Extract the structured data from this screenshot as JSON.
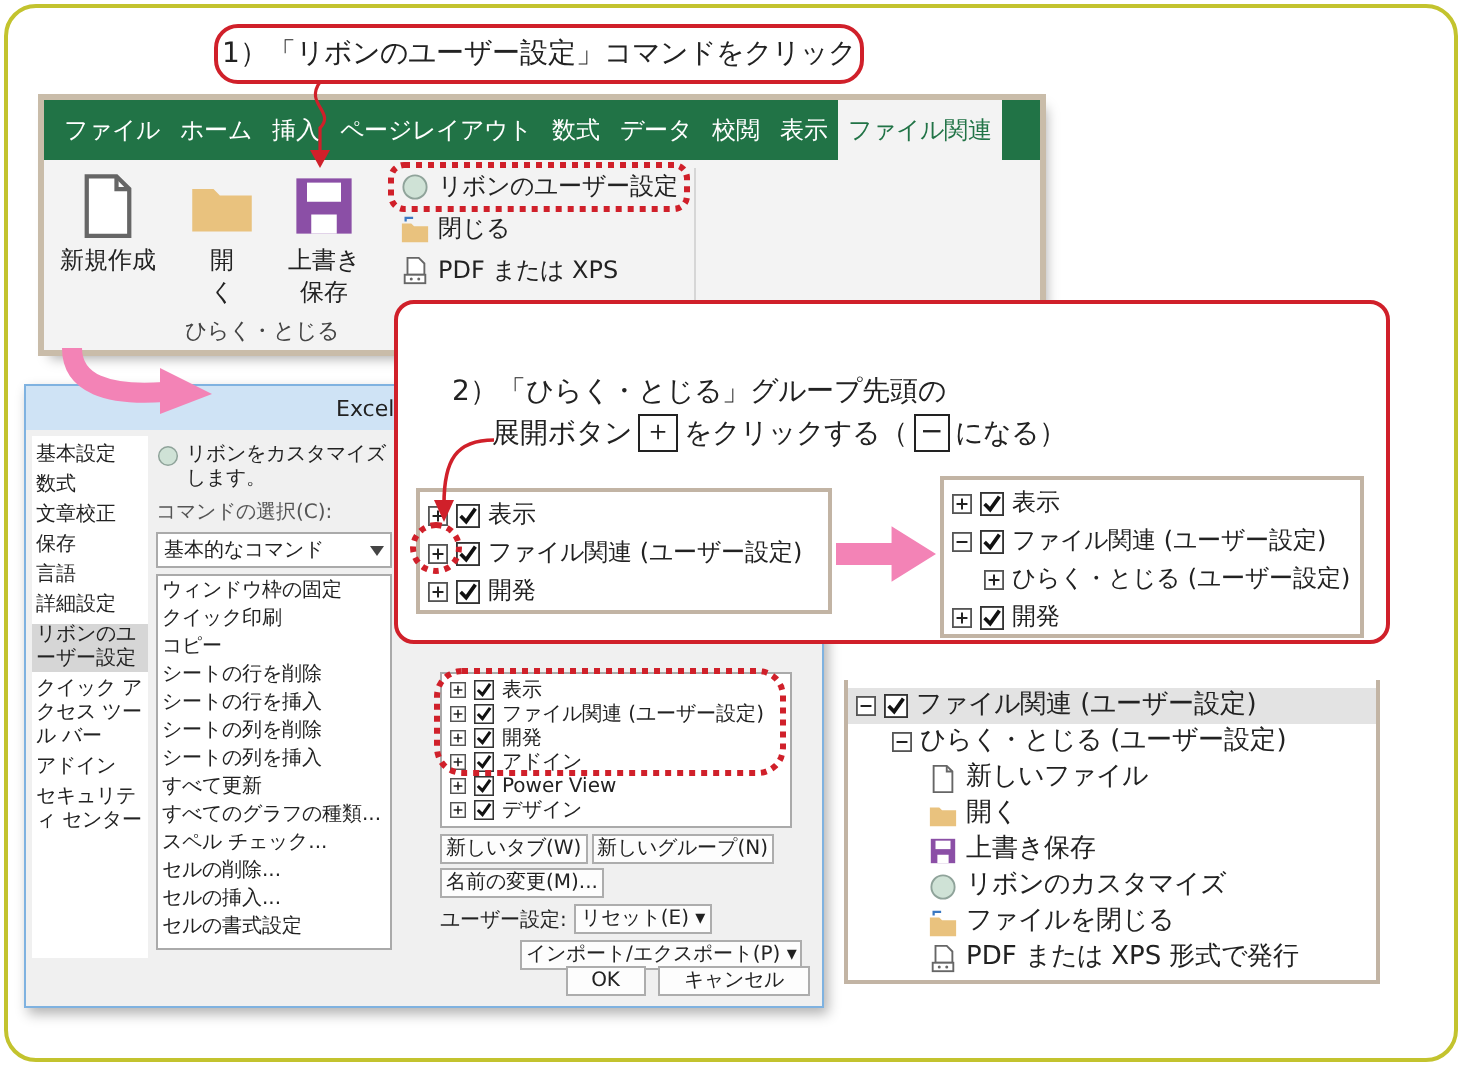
{
  "step1": {
    "text": "1）「リボンのユーザー設定」コマンドをクリック"
  },
  "ribbon": {
    "tabs": [
      {
        "label": "ファイル",
        "selected": false
      },
      {
        "label": "ホーム",
        "selected": false
      },
      {
        "label": "挿入",
        "selected": false
      },
      {
        "label": "ページレイアウト",
        "selected": false
      },
      {
        "label": "数式",
        "selected": false
      },
      {
        "label": "データ",
        "selected": false
      },
      {
        "label": "校閲",
        "selected": false
      },
      {
        "label": "表示",
        "selected": false
      },
      {
        "label": "ファイル関連",
        "selected": true
      }
    ],
    "large_buttons": [
      {
        "label": "新規作成",
        "kind": "new"
      },
      {
        "label": "開く",
        "kind": "open"
      },
      {
        "label": "上書き保存",
        "kind": "save"
      }
    ],
    "small_buttons": [
      {
        "label": "リボンのユーザー設定",
        "kind": "customize"
      },
      {
        "label": "閉じる",
        "kind": "close"
      },
      {
        "label": "PDF または XPS",
        "kind": "pdf"
      }
    ],
    "group_label": "ひらく・とじる"
  },
  "options_dialog": {
    "title": "Excel",
    "sidebar": [
      {
        "label": "基本設定",
        "selected": false
      },
      {
        "label": "数式",
        "selected": false
      },
      {
        "label": "文章校正",
        "selected": false
      },
      {
        "label": "保存",
        "selected": false
      },
      {
        "label": "言語",
        "selected": false
      },
      {
        "label": "詳細設定",
        "selected": false
      },
      {
        "label": "リボンのユーザー設定",
        "selected": true
      },
      {
        "label": "クイック アクセス ツール バー",
        "selected": false
      },
      {
        "label": "アドイン",
        "selected": false
      },
      {
        "label": "セキュリティ センター",
        "selected": false
      }
    ],
    "heading": "リボンをカスタマイズします。",
    "command_source_label": "コマンドの選択(C):",
    "command_source": "基本的なコマンド",
    "commands": [
      "ウィンドウ枠の固定",
      "クイック印刷",
      "コピー",
      "シートの行を削除",
      "シートの行を挿入",
      "シートの列を削除",
      "シートの列を挿入",
      "すべて更新",
      "すべてのグラフの種類...",
      "スペル チェック...",
      "セルの削除...",
      "セルの挿入...",
      "セルの書式設定"
    ],
    "tab_tree": [
      {
        "label": "表示",
        "kind": "tab",
        "checked": true,
        "expanded": false
      },
      {
        "label": "ファイル関連 (ユーザー設定)",
        "kind": "tab",
        "checked": true,
        "expanded": false
      },
      {
        "label": "開発",
        "kind": "tab",
        "checked": true,
        "expanded": false
      },
      {
        "label": "アドイン",
        "kind": "tab",
        "checked": true,
        "expanded": false
      },
      {
        "label": "Power View",
        "kind": "tab",
        "checked": true,
        "expanded": false
      },
      {
        "label": "デザイン",
        "kind": "tab",
        "checked": true,
        "expanded": false
      }
    ],
    "buttons": [
      "新しいタブ(W)",
      "新しいグループ(N)",
      "名前の変更(M)..."
    ],
    "custom_label": "ユーザー設定:",
    "reset": "リセット(E) ▾",
    "import_export": "インポート/エクスポート(P) ▾",
    "ok": "OK",
    "cancel": "キャンセル"
  },
  "step2": {
    "line1": "2）「ひらく・とじる」グループ先頭の",
    "before": "展開ボタン",
    "expand_symbol": "＋",
    "middle": "をクリックする（",
    "collapse_symbol": "−",
    "after": "になる）",
    "before_tree": [
      {
        "label": "表示",
        "kind": "tab",
        "checked": true,
        "expanded": false
      },
      {
        "label": "ファイル関連 (ユーザー設定)",
        "kind": "tab",
        "checked": true,
        "expanded": false
      },
      {
        "label": "開発",
        "kind": "tab",
        "checked": true,
        "expanded": false
      }
    ],
    "after_tree": [
      {
        "label": "表示",
        "kind": "tab",
        "checked": true,
        "expanded": false
      },
      {
        "label": "ファイル関連 (ユーザー設定)",
        "kind": "tab",
        "checked": true,
        "expanded": true,
        "children": [
          {
            "label": "ひらく・とじる (ユーザー設定)",
            "kind": "group",
            "expanded": false
          }
        ]
      },
      {
        "label": "開発",
        "kind": "tab",
        "checked": true,
        "expanded": false
      }
    ]
  },
  "result_tree": [
    {
      "label": "ファイル関連 (ユーザー設定)",
      "kind": "tab",
      "checked": true,
      "expanded": true,
      "selected": true,
      "children": [
        {
          "label": "ひらく・とじる (ユーザー設定)",
          "kind": "group",
          "expanded": true,
          "selected": false,
          "children": [
            {
              "label": "新しいファイル",
              "kind": "new",
              "selected": false
            },
            {
              "label": "開く",
              "kind": "open",
              "selected": false
            },
            {
              "label": "上書き保存",
              "kind": "save",
              "selected": false
            },
            {
              "label": "リボンのカスタマイズ",
              "kind": "customize",
              "selected": false
            },
            {
              "label": "ファイルを閉じる",
              "kind": "close",
              "selected": false
            },
            {
              "label": "PDF または XPS 形式で発行",
              "kind": "pdf",
              "selected": false
            }
          ]
        }
      ]
    }
  ]
}
